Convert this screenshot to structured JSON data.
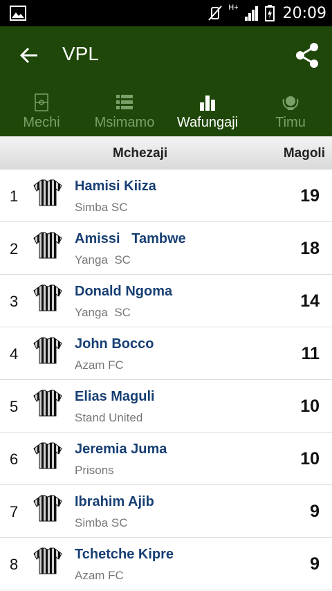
{
  "status_bar": {
    "time": "20:09",
    "network": "H+"
  },
  "app_bar": {
    "title": "VPL"
  },
  "tabs": [
    {
      "label": "Mechi",
      "icon": "pitch-icon"
    },
    {
      "label": "Msimamo",
      "icon": "standings-list-icon"
    },
    {
      "label": "Wafungaji",
      "icon": "bar-chart-icon"
    },
    {
      "label": "Timu",
      "icon": "team-crest-icon"
    }
  ],
  "active_tab": "Wafungaji",
  "table_header": {
    "player": "Mchezaji",
    "goals": "Magoli"
  },
  "scorers": [
    {
      "rank": "1",
      "name": "Hamisi Kiiza",
      "team": "Simba SC",
      "goals": "19"
    },
    {
      "rank": "2",
      "name": "Amissi   Tambwe",
      "team": "Yanga  SC",
      "goals": "18"
    },
    {
      "rank": "3",
      "name": "Donald Ngoma",
      "team": "Yanga  SC",
      "goals": "14"
    },
    {
      "rank": "4",
      "name": "John Bocco",
      "team": "Azam FC",
      "goals": "11"
    },
    {
      "rank": "5",
      "name": "Elias Maguli",
      "team": "Stand United",
      "goals": "10"
    },
    {
      "rank": "6",
      "name": "Jeremia Juma",
      "team": "Prisons",
      "goals": "10"
    },
    {
      "rank": "7",
      "name": "Ibrahim Ajib",
      "team": "Simba SC",
      "goals": "9"
    },
    {
      "rank": "8",
      "name": "Tchetche Kipre",
      "team": "Azam FC",
      "goals": "9"
    }
  ],
  "colors": {
    "app_bar": "#1f4709",
    "name_text": "#173f73",
    "inactive_tab": "#7aa06a"
  }
}
